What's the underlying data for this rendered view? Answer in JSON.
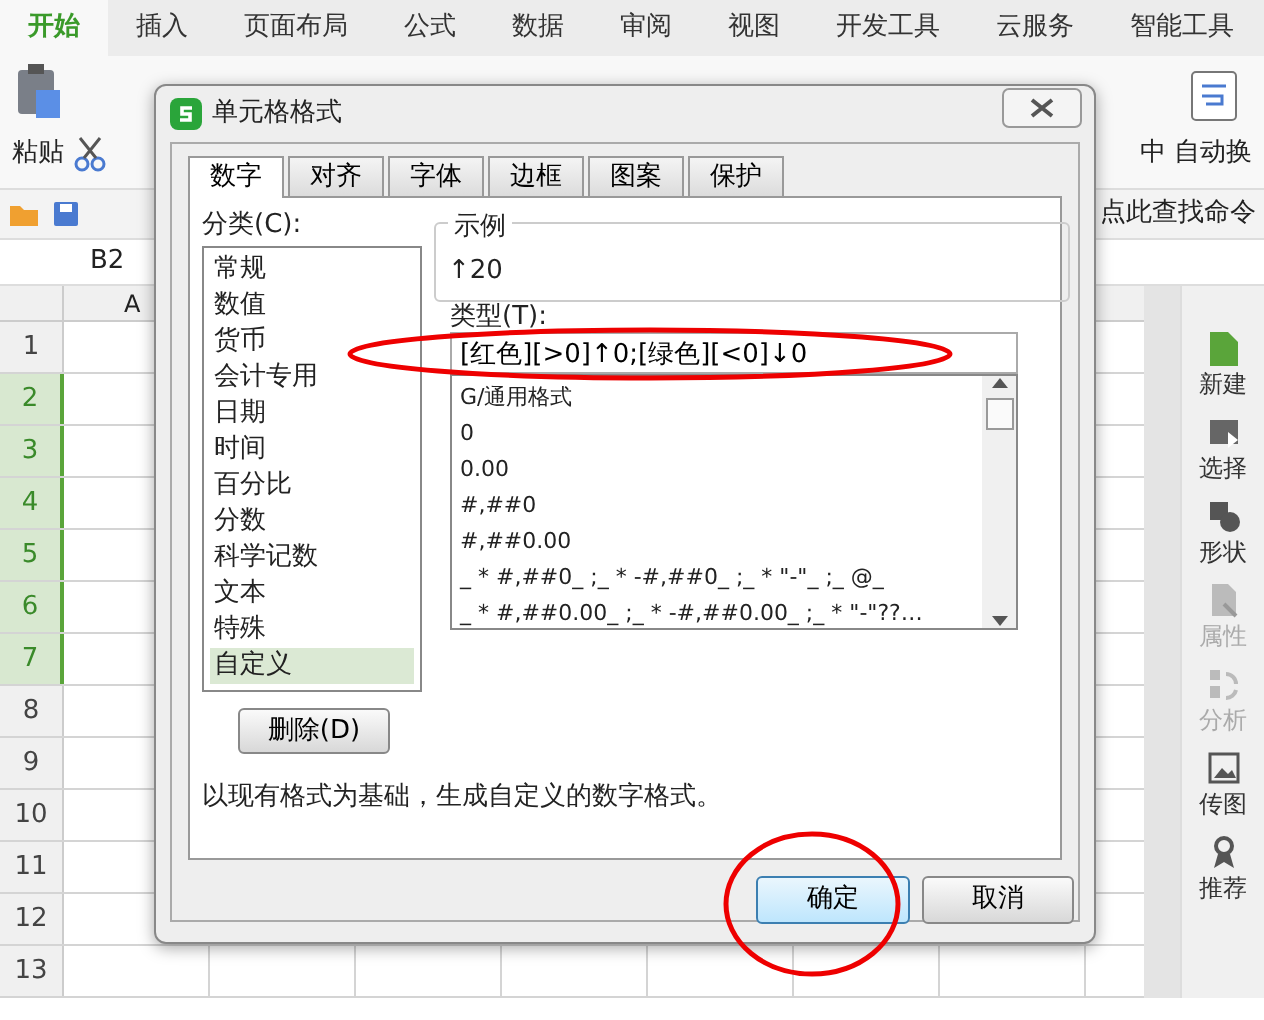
{
  "ribbon": {
    "tabs": [
      {
        "label": "开始",
        "selected": true
      },
      {
        "label": "插入",
        "selected": false
      },
      {
        "label": "页面布局",
        "selected": false
      },
      {
        "label": "公式",
        "selected": false
      },
      {
        "label": "数据",
        "selected": false
      },
      {
        "label": "审阅",
        "selected": false
      },
      {
        "label": "视图",
        "selected": false
      },
      {
        "label": "开发工具",
        "selected": false
      },
      {
        "label": "云服务",
        "selected": false
      },
      {
        "label": "智能工具",
        "selected": false
      }
    ],
    "paste_label": "粘贴",
    "merge_label": "中",
    "wrap_label": "自动换"
  },
  "find_command": "点此查找命令",
  "cell_ref": "B2",
  "column_header": "A",
  "rows": [
    {
      "label": "1",
      "selected": false
    },
    {
      "label": "2",
      "selected": true
    },
    {
      "label": "3",
      "selected": true
    },
    {
      "label": "4",
      "selected": true
    },
    {
      "label": "5",
      "selected": true
    },
    {
      "label": "6",
      "selected": true
    },
    {
      "label": "7",
      "selected": true
    },
    {
      "label": "8",
      "selected": false
    },
    {
      "label": "9",
      "selected": false
    },
    {
      "label": "10",
      "selected": false
    },
    {
      "label": "11",
      "selected": false
    },
    {
      "label": "12",
      "selected": false
    },
    {
      "label": "13",
      "selected": false
    }
  ],
  "side_panel": [
    {
      "label": "新建",
      "kind": "new",
      "disabled": false
    },
    {
      "label": "选择",
      "kind": "select",
      "disabled": false
    },
    {
      "label": "形状",
      "kind": "shape",
      "disabled": false
    },
    {
      "label": "属性",
      "kind": "property",
      "disabled": true
    },
    {
      "label": "分析",
      "kind": "analyze",
      "disabled": true
    },
    {
      "label": "传图",
      "kind": "image",
      "disabled": false
    },
    {
      "label": "推荐",
      "kind": "recommend",
      "disabled": false
    }
  ],
  "dialog": {
    "title": "单元格格式",
    "tabs": [
      {
        "label": "数字",
        "selected": true
      },
      {
        "label": "对齐",
        "selected": false
      },
      {
        "label": "字体",
        "selected": false
      },
      {
        "label": "边框",
        "selected": false
      },
      {
        "label": "图案",
        "selected": false
      },
      {
        "label": "保护",
        "selected": false
      }
    ],
    "category_label": "分类(C):",
    "categories": [
      {
        "label": "常规",
        "selected": false
      },
      {
        "label": "数值",
        "selected": false
      },
      {
        "label": "货币",
        "selected": false
      },
      {
        "label": "会计专用",
        "selected": false
      },
      {
        "label": "日期",
        "selected": false
      },
      {
        "label": "时间",
        "selected": false
      },
      {
        "label": "百分比",
        "selected": false
      },
      {
        "label": "分数",
        "selected": false
      },
      {
        "label": "科学记数",
        "selected": false
      },
      {
        "label": "文本",
        "selected": false
      },
      {
        "label": "特殊",
        "selected": false
      },
      {
        "label": "自定义",
        "selected": true
      }
    ],
    "sample_label": "示例",
    "sample_value": "↑20",
    "type_label": "类型(T):",
    "type_value": "[红色][>0]↑0;[绿色][<0]↓0",
    "formats": [
      "G/通用格式",
      "0",
      "0.00",
      "#,##0",
      "#,##0.00",
      "_ * #,##0_ ;_ * -#,##0_ ;_ * \"-\"_ ;_ @_",
      "_ * #,##0.00_ ;_ * -#,##0.00_ ;_ * \"-\"??…"
    ],
    "delete_button": "删除(D)",
    "description": "以现有格式为基础，生成自定义的数字格式。",
    "ok_button": "确定",
    "cancel_button": "取消"
  }
}
